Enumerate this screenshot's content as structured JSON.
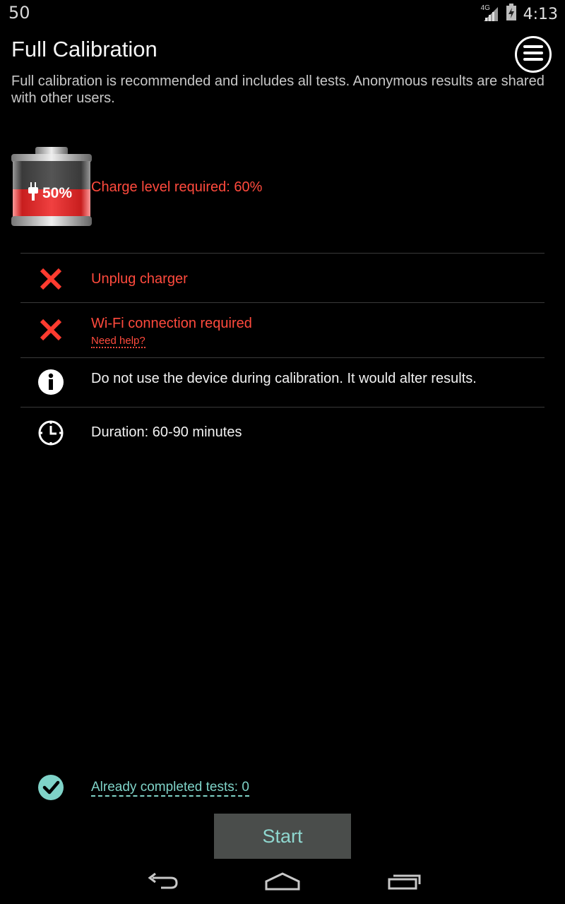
{
  "status_bar": {
    "left_text": "50",
    "network_label": "4G",
    "time": "4:13"
  },
  "header": {
    "title": "Full Calibration",
    "subtitle": "Full calibration is recommended and includes all tests. Anonymous results are shared with other users.",
    "menu_icon": "hamburger-menu-icon"
  },
  "battery": {
    "level_label": "50%",
    "level_fraction": 0.5,
    "requirement": "Charge level required: 60%"
  },
  "requirements": [
    {
      "icon": "x-icon",
      "text": "Unplug charger"
    },
    {
      "icon": "x-icon",
      "text": "Wi-Fi connection required",
      "help_link": "Need help?"
    },
    {
      "icon": "info-icon",
      "text": "Do not use the device during calibration. It would alter results."
    },
    {
      "icon": "clock-icon",
      "text": "Duration: 60-90 minutes"
    }
  ],
  "footer": {
    "completed_tests": "Already completed tests: 0",
    "start_label": "Start"
  },
  "colors": {
    "error": "#ff4a3d",
    "accent": "#7fd3c8",
    "button_bg": "#4a4d4b"
  }
}
